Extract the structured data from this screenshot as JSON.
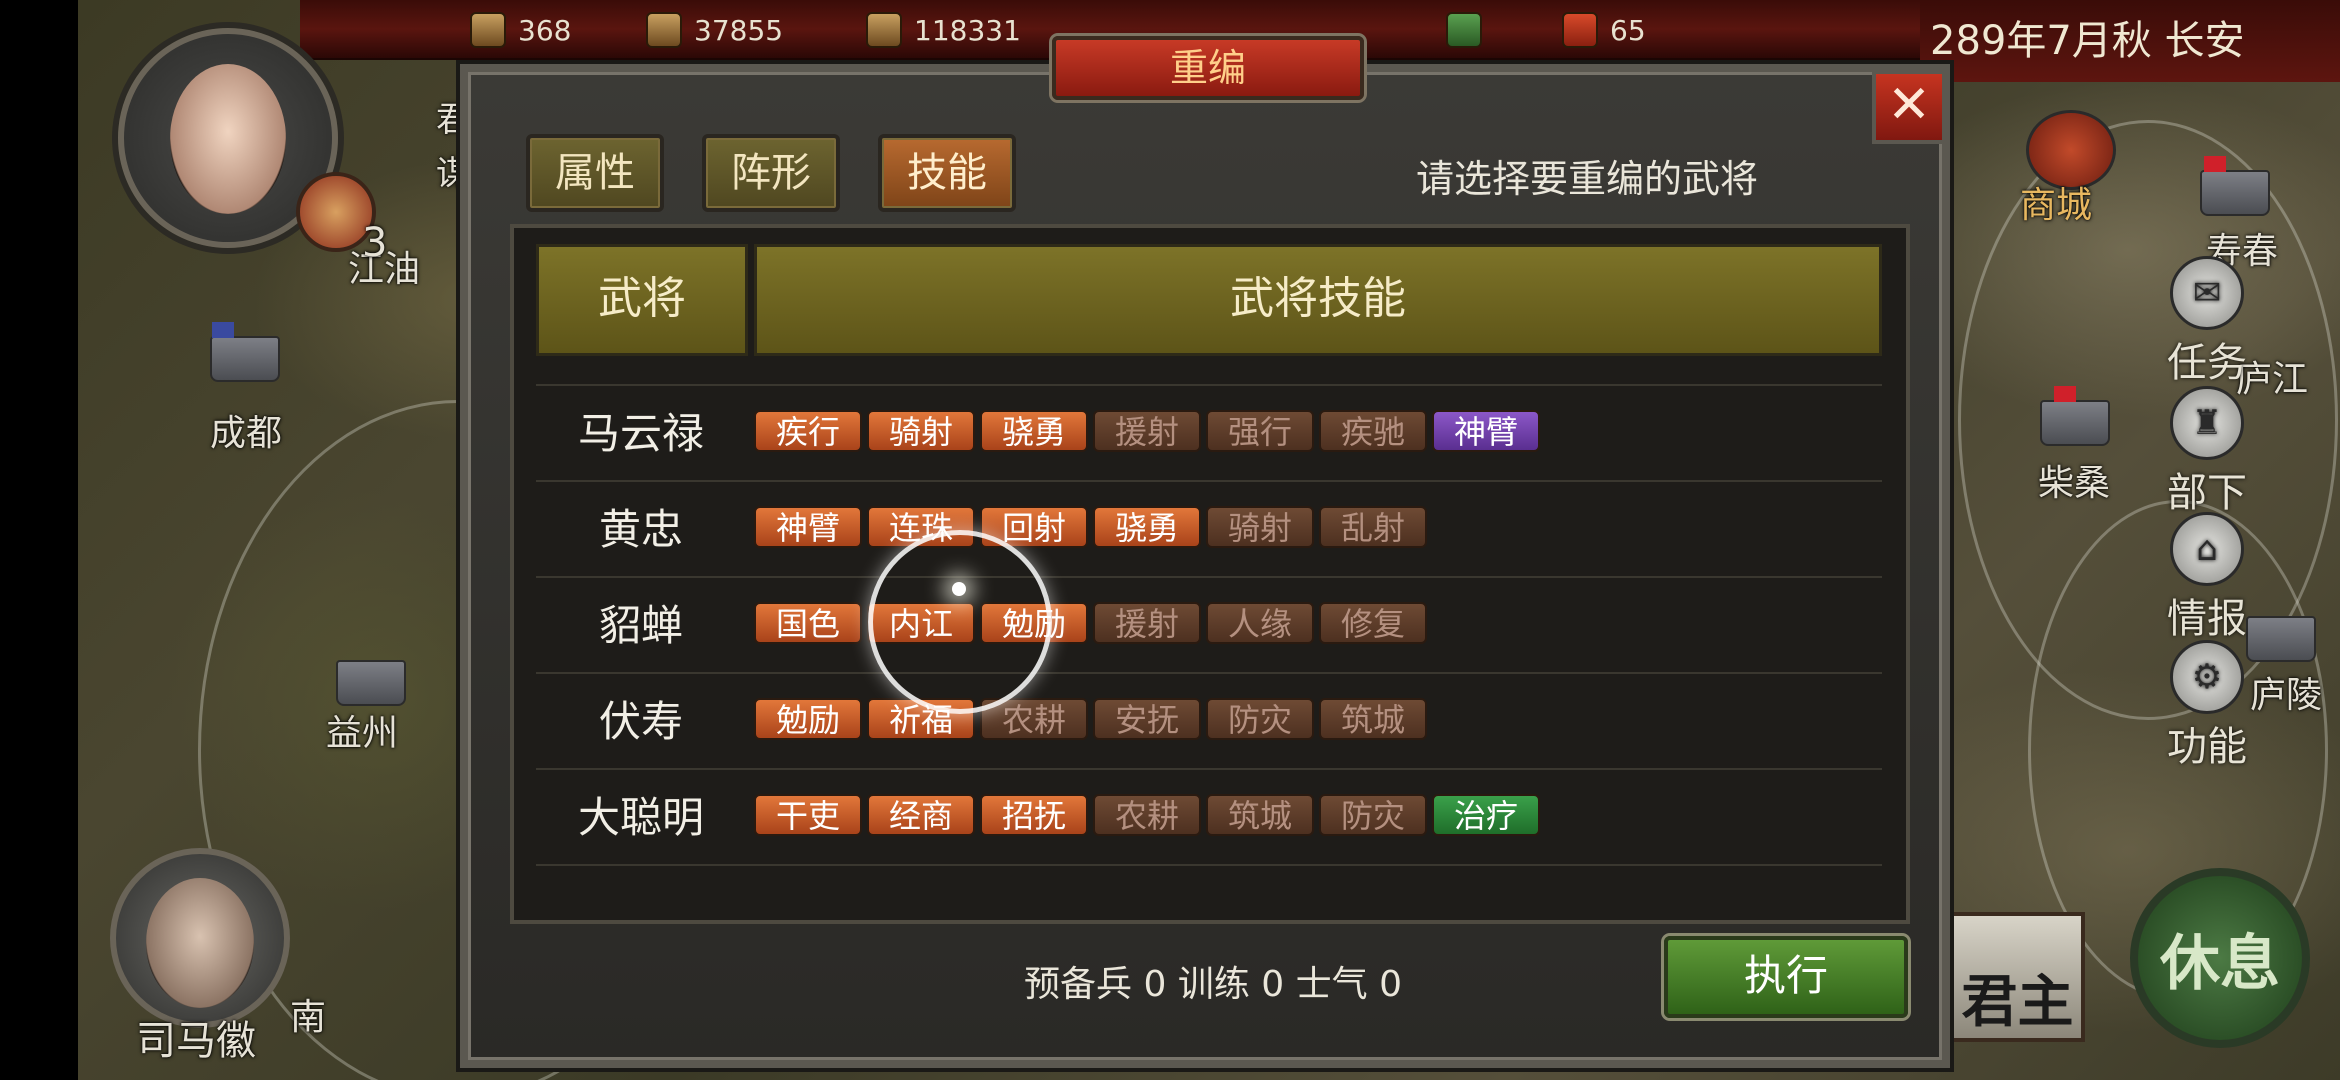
{
  "top_resources": [
    {
      "icon": "food-sack-icon",
      "value": "368"
    },
    {
      "icon": "money-bag-icon",
      "value": "37855"
    },
    {
      "icon": "grain-icon",
      "value": "118331"
    },
    {
      "icon": "medical-kit-icon",
      "value": ""
    },
    {
      "icon": "scroll-icon",
      "value": "65"
    }
  ],
  "date_location": "289年7月秋 长安",
  "map": {
    "cities": [
      "江油",
      "成都",
      "益州",
      "柴桑",
      "庐江",
      "庐陵",
      "寿春",
      "南"
    ],
    "shop_label": "商城"
  },
  "left_panel": {
    "badge_number": "3",
    "partial_text": [
      "君",
      "谋"
    ],
    "advisor_name": "司马徽"
  },
  "right_menu": [
    {
      "label": "任务",
      "icon": "scroll-icon"
    },
    {
      "label": "部下",
      "icon": "helmet-icon"
    },
    {
      "label": "情报",
      "icon": "building-icon"
    },
    {
      "label": "功能",
      "icon": "gear-icon"
    }
  ],
  "lord_label": "君主",
  "rest_label": "休息",
  "dialog": {
    "title": "重编",
    "close_symbol": "✕",
    "tabs": [
      {
        "label": "属性",
        "active": false
      },
      {
        "label": "阵形",
        "active": false
      },
      {
        "label": "技能",
        "active": true
      }
    ],
    "prompt": "请选择要重编的武将",
    "header": {
      "general": "武将",
      "skills": "武将技能"
    },
    "rows": [
      {
        "name": "马云禄",
        "skills": [
          {
            "label": "疾行",
            "state": "on"
          },
          {
            "label": "骑射",
            "state": "on"
          },
          {
            "label": "骁勇",
            "state": "on"
          },
          {
            "label": "援射",
            "state": "off"
          },
          {
            "label": "强行",
            "state": "off"
          },
          {
            "label": "疾驰",
            "state": "off"
          },
          {
            "label": "神臂",
            "state": "purple"
          }
        ]
      },
      {
        "name": "黄忠",
        "skills": [
          {
            "label": "神臂",
            "state": "on"
          },
          {
            "label": "连珠",
            "state": "on"
          },
          {
            "label": "回射",
            "state": "on"
          },
          {
            "label": "骁勇",
            "state": "on"
          },
          {
            "label": "骑射",
            "state": "off"
          },
          {
            "label": "乱射",
            "state": "off"
          }
        ]
      },
      {
        "name": "貂蝉",
        "skills": [
          {
            "label": "国色",
            "state": "on"
          },
          {
            "label": "内讧",
            "state": "on"
          },
          {
            "label": "勉励",
            "state": "on"
          },
          {
            "label": "援射",
            "state": "off"
          },
          {
            "label": "人缘",
            "state": "off"
          },
          {
            "label": "修复",
            "state": "off"
          }
        ]
      },
      {
        "name": "伏寿",
        "skills": [
          {
            "label": "勉励",
            "state": "on"
          },
          {
            "label": "祈福",
            "state": "on"
          },
          {
            "label": "农耕",
            "state": "off"
          },
          {
            "label": "安抚",
            "state": "off"
          },
          {
            "label": "防灾",
            "state": "off"
          },
          {
            "label": "筑城",
            "state": "off"
          }
        ]
      },
      {
        "name": "大聪明",
        "skills": [
          {
            "label": "干吏",
            "state": "on"
          },
          {
            "label": "经商",
            "state": "on"
          },
          {
            "label": "招抚",
            "state": "on"
          },
          {
            "label": "农耕",
            "state": "off"
          },
          {
            "label": "筑城",
            "state": "off"
          },
          {
            "label": "防灾",
            "state": "off"
          },
          {
            "label": "治疗",
            "state": "green"
          }
        ]
      }
    ],
    "stats": {
      "reserve_label": "预备兵",
      "reserve": "0",
      "training_label": "训练",
      "training": "0",
      "morale_label": "士气",
      "morale": "0"
    },
    "execute_label": "执行"
  }
}
